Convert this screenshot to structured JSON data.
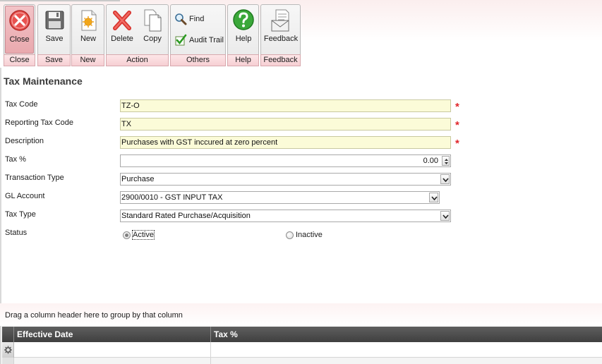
{
  "ribbon": {
    "groups": {
      "close": "Close",
      "save": "Save",
      "new": "New",
      "action": "Action",
      "others": "Others",
      "help": "Help",
      "feedback": "Feedback"
    },
    "buttons": {
      "close": "Close",
      "save": "Save",
      "new": "New",
      "delete": "Delete",
      "copy": "Copy",
      "find": "Find",
      "audit_trail": "Audit Trail",
      "help": "Help",
      "feedback": "Feedback"
    },
    "icons": {
      "close": "close-circle-icon",
      "save": "floppy-disk-icon",
      "new": "new-document-icon",
      "delete": "delete-x-icon",
      "copy": "copy-icon",
      "find": "magnifier-icon",
      "audit_trail": "checkbox-check-icon",
      "help": "help-question-icon",
      "feedback": "feedback-envelope-icon"
    }
  },
  "page": {
    "title": "Tax Maintenance"
  },
  "form": {
    "tax_code": {
      "label": "Tax Code",
      "value": "TZ-O",
      "required": "*"
    },
    "reporting_tax_code": {
      "label": "Reporting Tax Code",
      "value": "TX",
      "required": "*"
    },
    "description": {
      "label": "Description",
      "value": "Purchases with GST inccured at zero percent",
      "required": "*"
    },
    "tax_percent": {
      "label": "Tax %",
      "value": "0.00"
    },
    "transaction_type": {
      "label": "Transaction Type",
      "value": "Purchase"
    },
    "gl_account": {
      "label": "GL Account",
      "value": "2900/0010 - GST INPUT TAX"
    },
    "tax_type": {
      "label": "Tax Type",
      "value": "Standard Rated Purchase/Acquisition"
    },
    "status": {
      "label": "Status",
      "options": [
        "Active",
        "Inactive"
      ],
      "selected": "Active"
    }
  },
  "grid": {
    "group_hint": "Drag a column header here to group by that column",
    "columns": [
      "Effective Date",
      "Tax %"
    ]
  },
  "colors": {
    "required_bg": "#fbfbd8",
    "required_star": "#e0262b",
    "ribbon_footer": "#f6cfd3",
    "grid_header": "#4a4a4a"
  }
}
